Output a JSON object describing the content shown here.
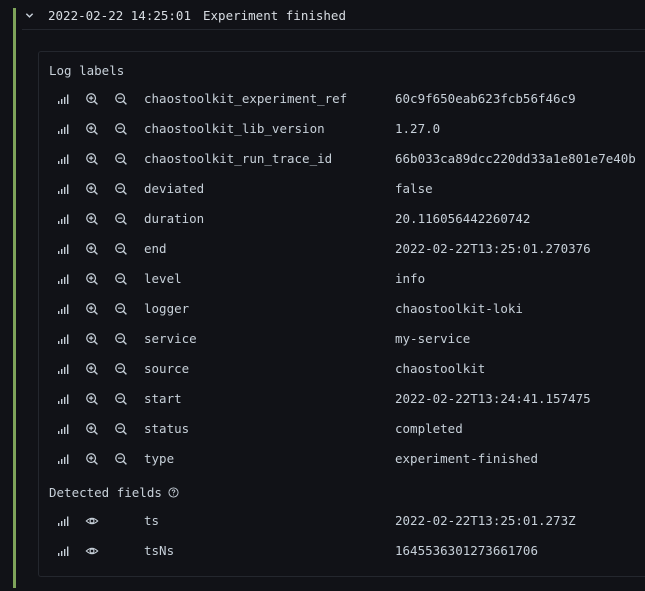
{
  "log": {
    "timestamp": "2022-02-22 14:25:01",
    "message": "Experiment finished"
  },
  "sections": {
    "log_labels_title": "Log labels",
    "detected_fields_title": "Detected fields"
  },
  "labels": [
    {
      "key": "chaostoolkit_experiment_ref",
      "value": "60c9f650eab623fcb56f46c9"
    },
    {
      "key": "chaostoolkit_lib_version",
      "value": "1.27.0"
    },
    {
      "key": "chaostoolkit_run_trace_id",
      "value": "66b033ca89dcc220dd33a1e801e7e40b"
    },
    {
      "key": "deviated",
      "value": "false"
    },
    {
      "key": "duration",
      "value": "20.116056442260742"
    },
    {
      "key": "end",
      "value": "2022-02-22T13:25:01.270376"
    },
    {
      "key": "level",
      "value": "info"
    },
    {
      "key": "logger",
      "value": "chaostoolkit-loki"
    },
    {
      "key": "service",
      "value": "my-service"
    },
    {
      "key": "source",
      "value": "chaostoolkit"
    },
    {
      "key": "start",
      "value": "2022-02-22T13:24:41.157475"
    },
    {
      "key": "status",
      "value": "completed"
    },
    {
      "key": "type",
      "value": "experiment-finished"
    }
  ],
  "detected_fields": [
    {
      "key": "ts",
      "value": "2022-02-22T13:25:01.273Z"
    },
    {
      "key": "tsNs",
      "value": "1645536301273661706"
    }
  ],
  "icons": {
    "stats": "stats-icon",
    "filter_for": "zoom-in-icon",
    "filter_out": "zoom-out-icon",
    "toggle_field": "eye-icon",
    "help": "question-circle-icon",
    "collapse": "chevron-down-icon"
  },
  "colors": {
    "background": "#111217",
    "level_bar": "#7ea35a",
    "text": "#c7d0d9",
    "border": "#24272e"
  }
}
